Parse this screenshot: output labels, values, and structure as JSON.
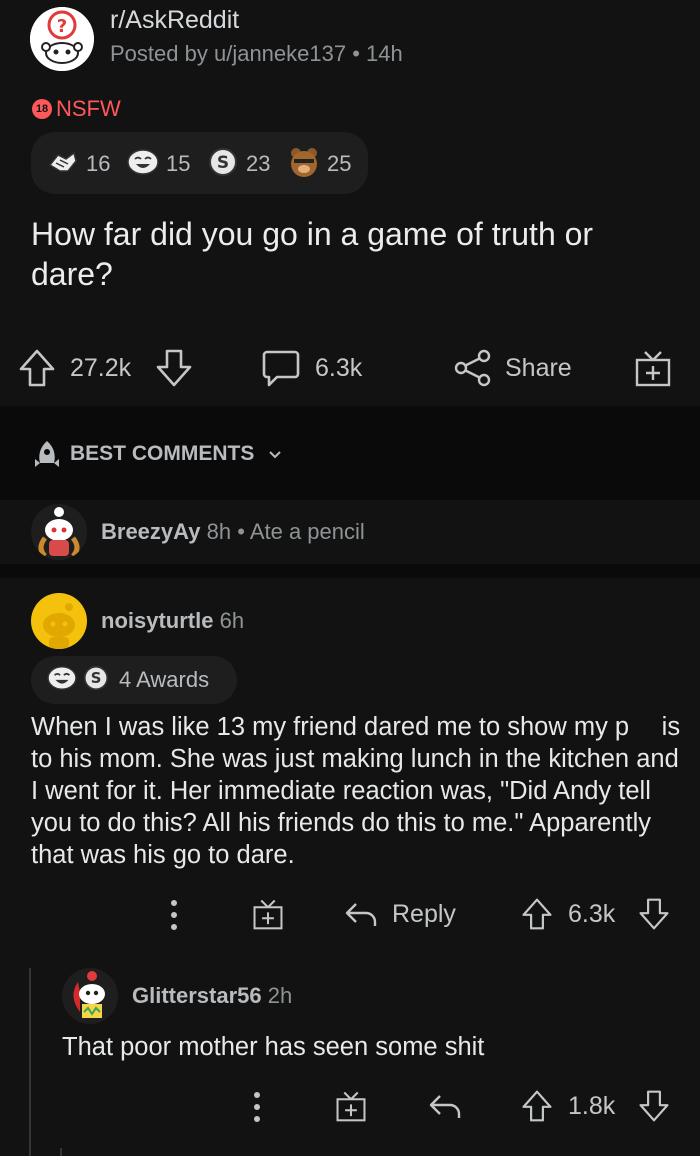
{
  "post": {
    "subreddit": "r/AskReddit",
    "posted_by_prefix": "Posted by",
    "author": "u/janneke137",
    "separator": "•",
    "age": "14h",
    "nsfw_badge_number": "18",
    "nsfw_label": "NSFW",
    "awards": [
      {
        "icon": "handshake-award-icon",
        "count": "16"
      },
      {
        "icon": "laughing-face-award-icon",
        "count": "15"
      },
      {
        "icon": "silver-coin-award-icon",
        "count": "23"
      },
      {
        "icon": "bear-award-icon",
        "count": "25"
      }
    ],
    "title": "How far did you go in a game of truth or dare?",
    "upvotes": "27.2k",
    "comments": "6.3k",
    "share_label": "Share"
  },
  "sort": {
    "label": "BEST COMMENTS"
  },
  "collapsed_comment": {
    "author": "BreezyAy",
    "age": "8h",
    "separator": "•",
    "flair_text": "Ate a pencil"
  },
  "comment": {
    "author": "noisyturtle",
    "age": "6h",
    "awards_label": "4 Awards",
    "body": "When I was like 13 my friend dared me to show my p  is to his mom. She was just making lunch in the kitchen and I went for it. Her immediate reaction was, \"Did Andy tell you to do this? All his friends do this to me.\" Apparently that was his go to dare.",
    "reply_label": "Reply",
    "score": "6.3k"
  },
  "reply": {
    "author": "Glitterstar56",
    "age": "2h",
    "body": "That poor mother has seen some shit",
    "score": "1.8k"
  },
  "colors": {
    "background": "#121212",
    "section_band": "#0a0a0a",
    "text": "#d7dadc",
    "muted": "#8e9396",
    "nsfw": "#ff585b",
    "avatar_yellow": "#f4c20d"
  }
}
